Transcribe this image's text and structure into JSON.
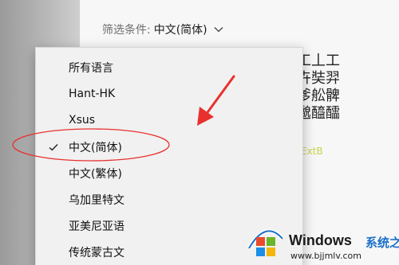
{
  "filter": {
    "label": "筛选条件:",
    "value": "中文(简体)",
    "chevron_icon": "chevron-down-icon"
  },
  "preview": {
    "glyph_lines": [
      "工丄工",
      "卉奘羿",
      "爹舩髀",
      "邈醯醽"
    ],
    "extension_label": "ExtB"
  },
  "dropdown": {
    "items": [
      {
        "label": "所有语言",
        "selected": false
      },
      {
        "label": "Hant-HK",
        "selected": false
      },
      {
        "label": "Xsus",
        "selected": false
      },
      {
        "label": "中文(简体)",
        "selected": true
      },
      {
        "label": "中文(繁体)",
        "selected": false
      },
      {
        "label": "乌加里特文",
        "selected": false
      },
      {
        "label": "亚美尼亚语",
        "selected": false
      },
      {
        "label": "传统蒙古文",
        "selected": false
      }
    ],
    "selected_icon": "checkmark-icon"
  },
  "annotation": {
    "highlight_color": "#e8312f",
    "arrow_color": "#e8312f"
  },
  "watermark": {
    "title": "Windows",
    "subtitle": "系统之家",
    "url": "www.bjjmlv.com",
    "brand_color": "#1b6fc8"
  }
}
